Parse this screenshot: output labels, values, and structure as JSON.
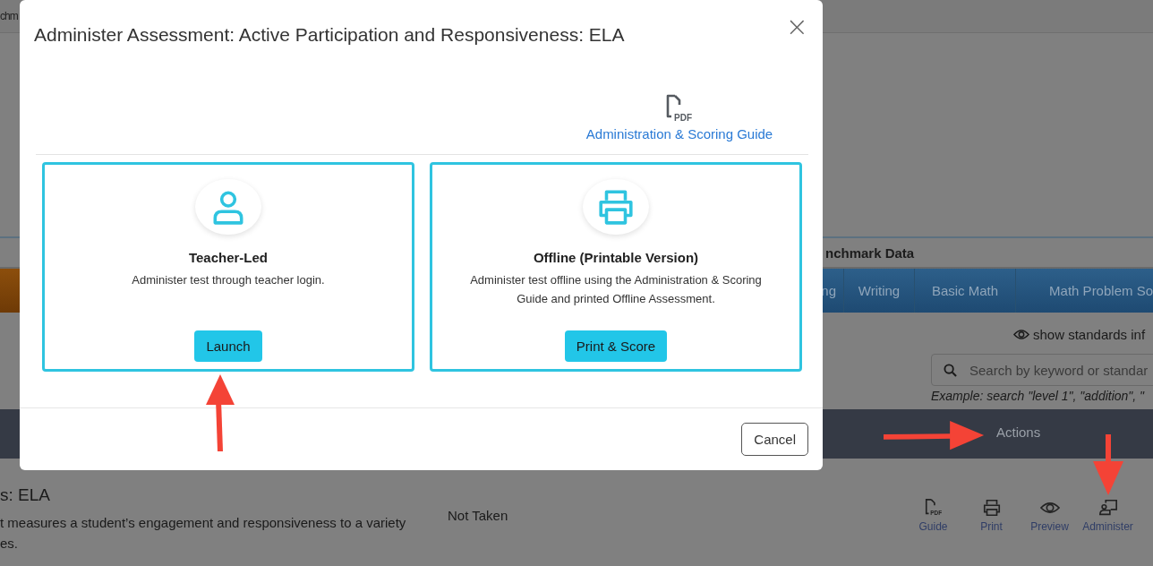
{
  "background": {
    "header_text": "chm",
    "section_tab": "nchmark Data",
    "tabs": [
      {
        "label": "ng"
      },
      {
        "label": "Writing"
      },
      {
        "label": "Basic Math"
      },
      {
        "label": "Math Problem So"
      }
    ],
    "show_standards": "show standards inf",
    "search": {
      "placeholder": "Search by keyword or standar"
    },
    "search_example": "Example: search \"level 1\", \"addition\", \"",
    "table_header": "Actions",
    "row": {
      "title": "s: ELA",
      "description_lines": [
        "t measures a student’s engagement and responsiveness to a variety",
        "es."
      ],
      "status": "Not Taken",
      "actions": [
        {
          "kind": "pdf",
          "icon_text": "PDF",
          "label": "Guide"
        },
        {
          "kind": "print",
          "label": "Print"
        },
        {
          "kind": "preview",
          "label": "Preview"
        },
        {
          "kind": "administer",
          "label": "Administer"
        }
      ]
    }
  },
  "modal": {
    "title": "Administer Assessment: Active Participation and Responsiveness: ELA",
    "close": "×",
    "guide_link": {
      "icon_text": "PDF",
      "label": "Administration & Scoring Guide"
    },
    "options": [
      {
        "kind": "teacher",
        "title": "Teacher-Led",
        "description": "Administer test through teacher login.",
        "button": "Launch"
      },
      {
        "kind": "print",
        "title": "Offline (Printable Version)",
        "description": "Administer test offline using the Administration & Scoring Guide and printed Offline Assessment.",
        "button": "Print & Score"
      }
    ],
    "cancel": "Cancel"
  }
}
